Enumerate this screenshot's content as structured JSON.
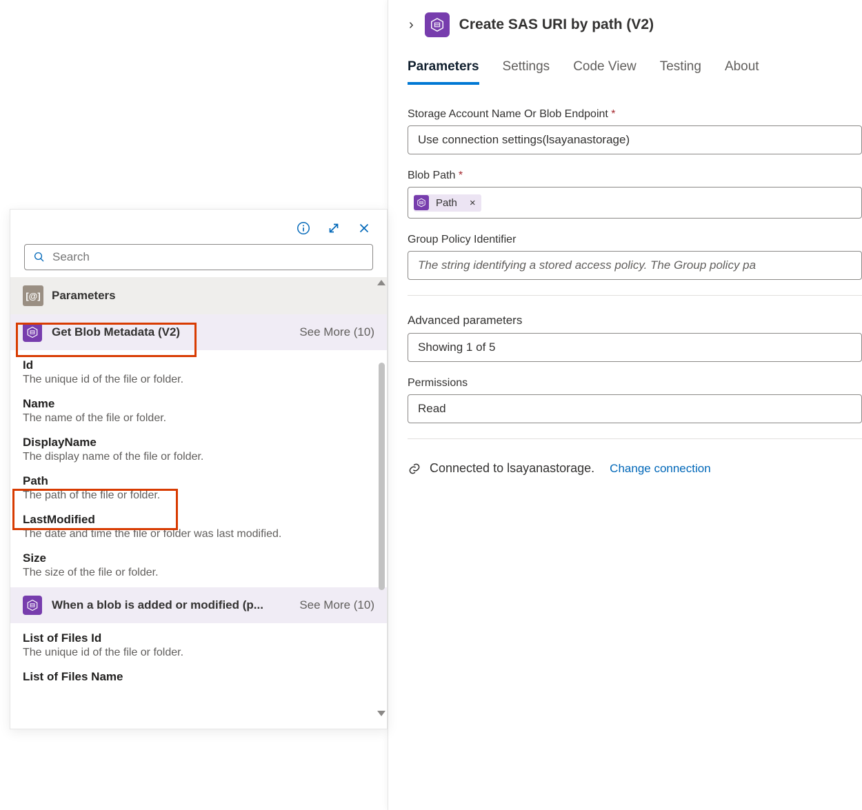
{
  "right": {
    "title": "Create SAS URI by path (V2)",
    "tabs": [
      "Parameters",
      "Settings",
      "Code View",
      "Testing",
      "About"
    ],
    "active_tab": 0,
    "fields": {
      "storage_label": "Storage Account Name Or Blob Endpoint",
      "storage_value": "Use connection settings(lsayanastorage)",
      "blobpath_label": "Blob Path",
      "blobpath_token": "Path",
      "gpi_label": "Group Policy Identifier",
      "gpi_placeholder": "The string identifying a stored access policy. The Group policy pa"
    },
    "advanced": {
      "title": "Advanced parameters",
      "showing": "Showing 1 of 5",
      "perm_label": "Permissions",
      "perm_value": "Read"
    },
    "connection": {
      "text": "Connected to lsayanastorage.",
      "change": "Change connection"
    }
  },
  "picker": {
    "search_placeholder": "Search",
    "group_header": "Parameters",
    "action1": {
      "name": "Get Blob Metadata (V2)",
      "seemore": "See More (10)"
    },
    "items1": [
      {
        "t": "Id",
        "d": "The unique id of the file or folder."
      },
      {
        "t": "Name",
        "d": "The name of the file or folder."
      },
      {
        "t": "DisplayName",
        "d": "The display name of the file or folder."
      },
      {
        "t": "Path",
        "d": "The path of the file or folder."
      },
      {
        "t": "LastModified",
        "d": "The date and time the file or folder was last modified."
      },
      {
        "t": "Size",
        "d": "The size of the file or folder."
      }
    ],
    "action2": {
      "name": "When a blob is added or modified (p...",
      "seemore": "See More (10)"
    },
    "items2": [
      {
        "t": "List of Files Id",
        "d": "The unique id of the file or folder."
      },
      {
        "t": "List of Files Name",
        "d": ""
      }
    ]
  }
}
